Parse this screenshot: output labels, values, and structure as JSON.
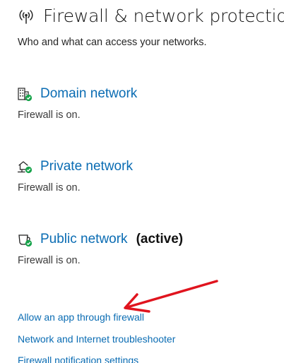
{
  "header": {
    "title": "Firewall & network protection",
    "icon": "antenna-broadcast-icon",
    "subtitle": "Who and what can access your networks."
  },
  "networks": [
    {
      "label": "Domain network",
      "status": "Firewall is on.",
      "icon": "building-shield-icon",
      "active_label": ""
    },
    {
      "label": "Private network",
      "status": "Firewall is on.",
      "icon": "home-network-shield-icon",
      "active_label": ""
    },
    {
      "label": "Public network",
      "status": "Firewall is on.",
      "icon": "cafe-shield-icon",
      "active_label": "(active)"
    }
  ],
  "links": {
    "allow_app": "Allow an app through firewall",
    "troubleshooter": "Network and Internet troubleshooter",
    "notification_settings": "Firewall notification settings"
  },
  "colors": {
    "link": "#0a6cb3",
    "status_ok": "#16a34a",
    "annotation_arrow": "#e0141e"
  }
}
